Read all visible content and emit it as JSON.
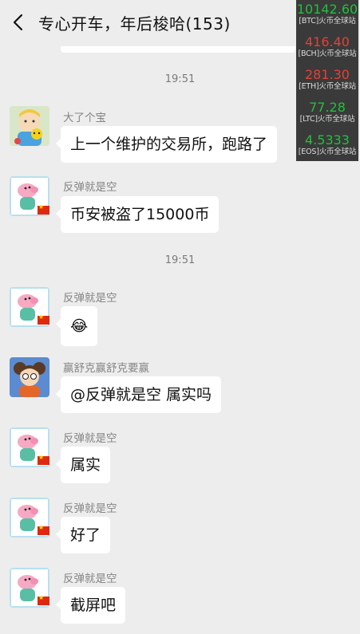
{
  "header": {
    "title": "专心开车，年后梭哈(153)"
  },
  "ticker": [
    {
      "price": "10142.60",
      "source": "[BTC]火币全球站",
      "trend": "up"
    },
    {
      "price": "416.40",
      "source": "[BCH]火币全球站",
      "trend": "down"
    },
    {
      "price": "281.30",
      "source": "[ETH]火币全球站",
      "trend": "down"
    },
    {
      "price": "77.28",
      "source": "[LTC]火币全球站",
      "trend": "up"
    },
    {
      "price": "4.5333",
      "source": "[EOS]火币全球站",
      "trend": "up"
    }
  ],
  "colors": {
    "up": "#22c03a",
    "down": "#e0413a",
    "ticker_bg": "#3a3a3a"
  },
  "chat": {
    "time1": "19:51",
    "time2": "19:51",
    "messages": [
      {
        "sender": "大了个宝",
        "text": "上一个维护的交易所，跑路了"
      },
      {
        "sender": "反弹就是空",
        "text": "币安被盗了15000币"
      },
      {
        "sender": "反弹就是空",
        "text": "😂"
      },
      {
        "sender": "赢舒克赢舒克要赢",
        "text": "@反弹就是空  属实吗"
      },
      {
        "sender": "反弹就是空",
        "text": "属实"
      },
      {
        "sender": "反弹就是空",
        "text": "好了"
      },
      {
        "sender": "反弹就是空",
        "text": "截屏吧"
      }
    ]
  }
}
